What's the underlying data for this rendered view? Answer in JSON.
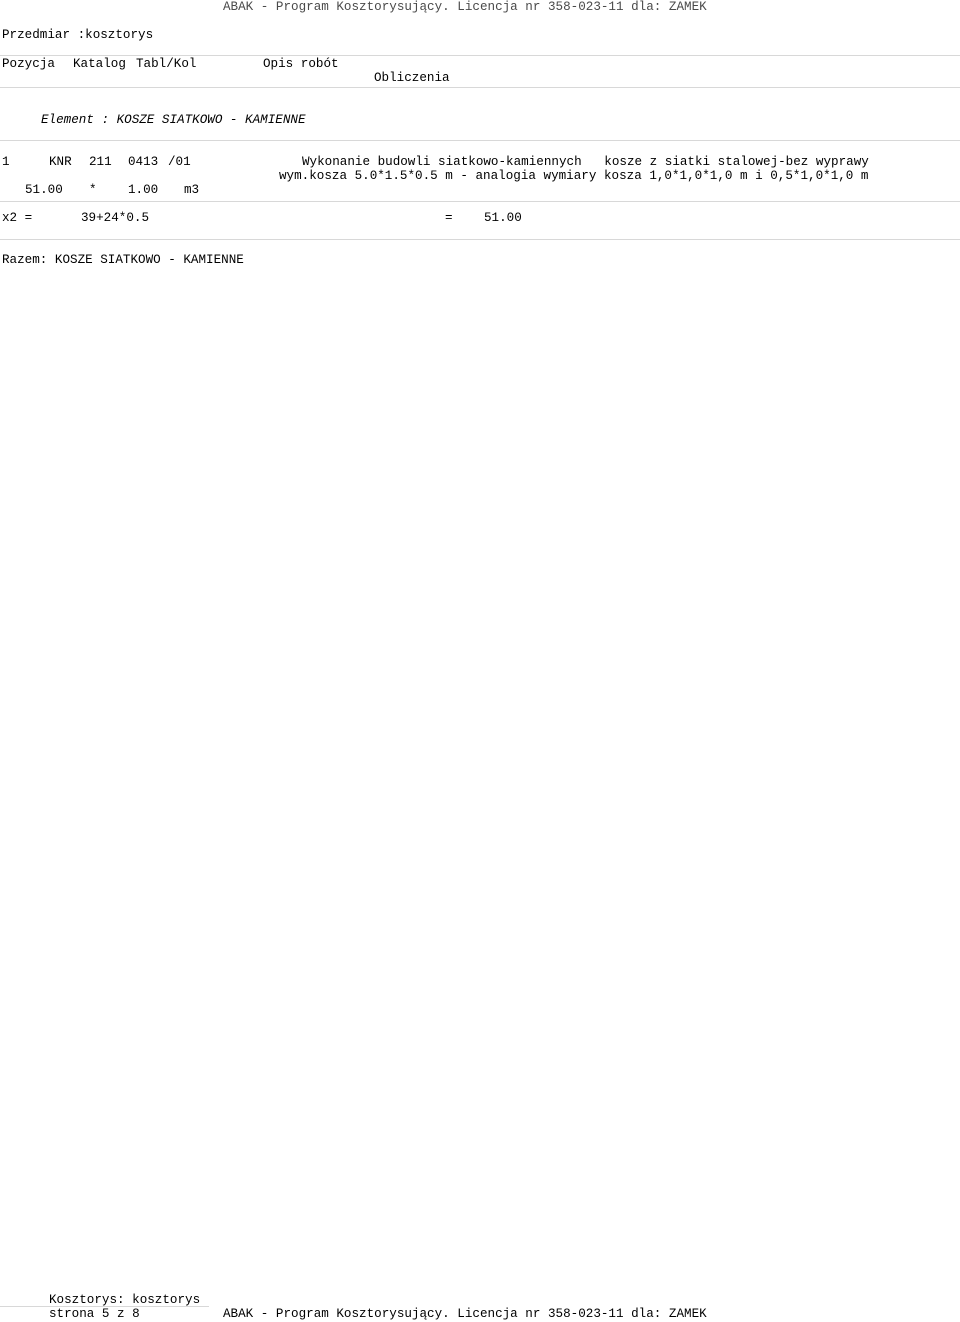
{
  "header": {
    "program_line": "ABAK - Program Kosztorysujący. Licencja nr 358-023-11 dla: ZAMEK",
    "title": "Przedmiar :kosztorys"
  },
  "columns": {
    "position": "Pozycja",
    "catalog": "Katalog",
    "table_col": "Tabl/Kol",
    "description": "Opis robót",
    "calculations": "Obliczenia"
  },
  "element": {
    "label": "Element : KOSZE SIATKOWO - KAMIENNE"
  },
  "item": {
    "number": "1",
    "catalog": "KNR",
    "catalog_no": "211",
    "table": "0413",
    "col": "/01",
    "description_line1": "Wykonanie budowli siatkowo-kamiennych   kosze z siatki stalowej-bez wyprawy",
    "description_line2": "wym.kosza 5.0*1.5*0.5 m - analogia wymiary kosza 1,0*1,0*1,0 m i 0,5*1,0*1,0 m",
    "quantity": "51.00",
    "multiply": "*",
    "factor": "1.00",
    "unit": "m3"
  },
  "calculation": {
    "variable": "x2 =",
    "formula": "39+24*0.5",
    "equals": "=",
    "result": "51.00"
  },
  "total": {
    "label": "Razem: KOSZE SIATKOWO - KAMIENNE"
  },
  "footer": {
    "estimate": "Kosztorys: kosztorys",
    "page": "strona 5 z 8",
    "program_line": "ABAK - Program Kosztorysujący. Licencja nr 358-023-11 dla: ZAMEK"
  }
}
